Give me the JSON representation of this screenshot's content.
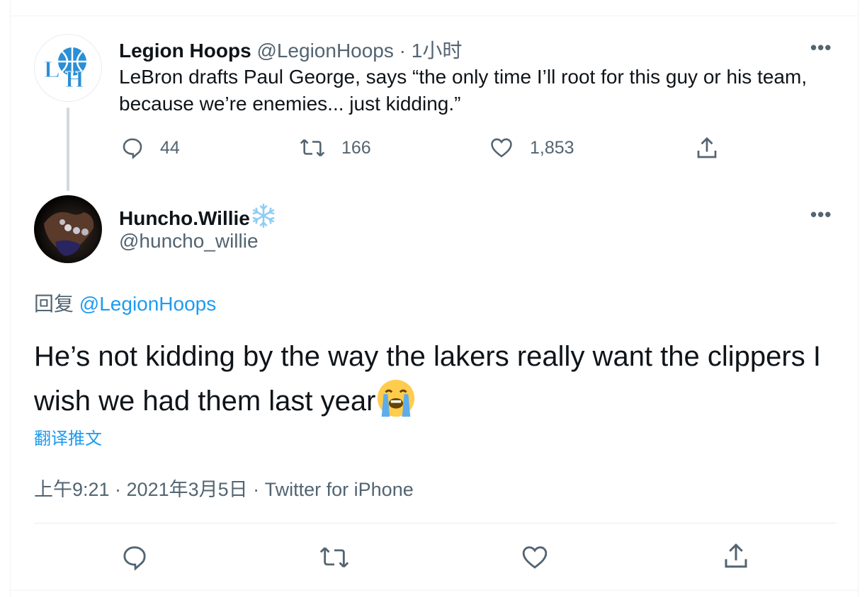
{
  "parent_tweet": {
    "name": "Legion Hoops",
    "handle": "@LegionHoops",
    "separator": " · ",
    "time": "1小时",
    "text": "LeBron drafts Paul George, says “the only time I’ll root for this guy or his team, because we’re enemies... just kidding.”",
    "avatar_label": "LH",
    "replies": "44",
    "retweets": "166",
    "likes": "1,853"
  },
  "main_tweet": {
    "name": "Huncho.Willie",
    "name_emoji": "❄",
    "handle": "@huncho_willie",
    "reply_prefix": "回复",
    "reply_to": "@LegionHoops",
    "text": "He’s not kidding by the way the lakers really want the clippers I wish we had them last year",
    "text_emoji": "loudly-crying-face",
    "translate_label": "翻译推文",
    "timestamp": "上午9:21 · 2021年3月5日 · Twitter for iPhone"
  },
  "colors": {
    "link": "#1d9bf0",
    "secondary_text": "#536471",
    "primary_text": "#0f1419",
    "snowflake": "#8ecdf2"
  }
}
